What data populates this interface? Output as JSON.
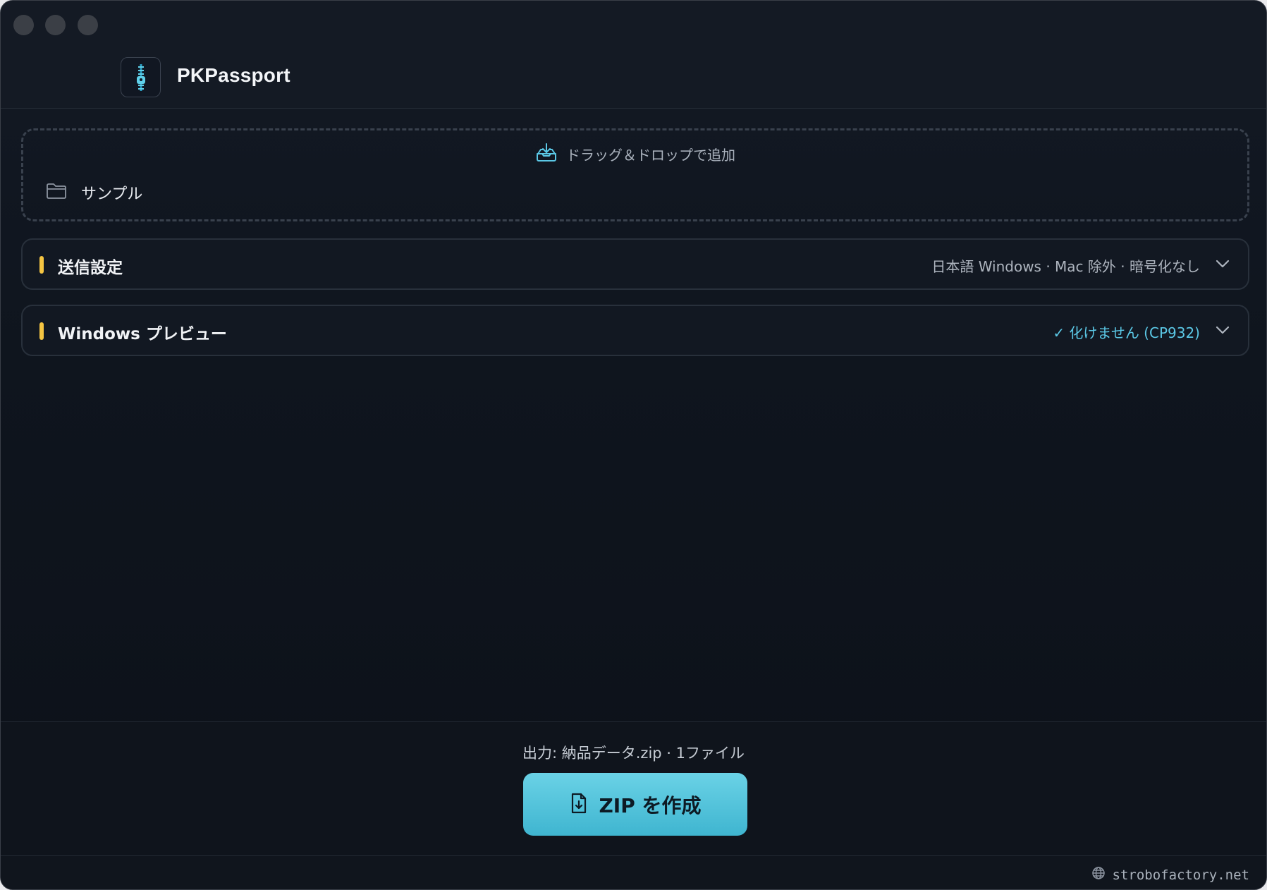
{
  "app": {
    "title": "PKPassport",
    "icon": "zipper-icon"
  },
  "dropzone": {
    "hint": "ドラッグ＆ドロップで追加",
    "hint_icon": "tray-download-icon",
    "item_label": "サンプル",
    "item_icon": "folder-icon"
  },
  "panels": [
    {
      "title": "送信設定",
      "summary": "日本語 Windows · Mac 除外 · 暗号化なし"
    },
    {
      "title": "Windows プレビュー",
      "summary": "✓ 化けません (CP932)"
    }
  ],
  "footer": {
    "output": "出力: 納品データ.zip · 1ファイル",
    "button_label": "ZIP を作成",
    "button_icon": "file-download-icon"
  },
  "status": {
    "site": "strobofactory.net",
    "site_icon": "globe-icon"
  },
  "colors": {
    "accent": "#f5c542",
    "primary": "#4cc3dc",
    "ok": "#5bc8e6",
    "background": "#0f151e"
  }
}
